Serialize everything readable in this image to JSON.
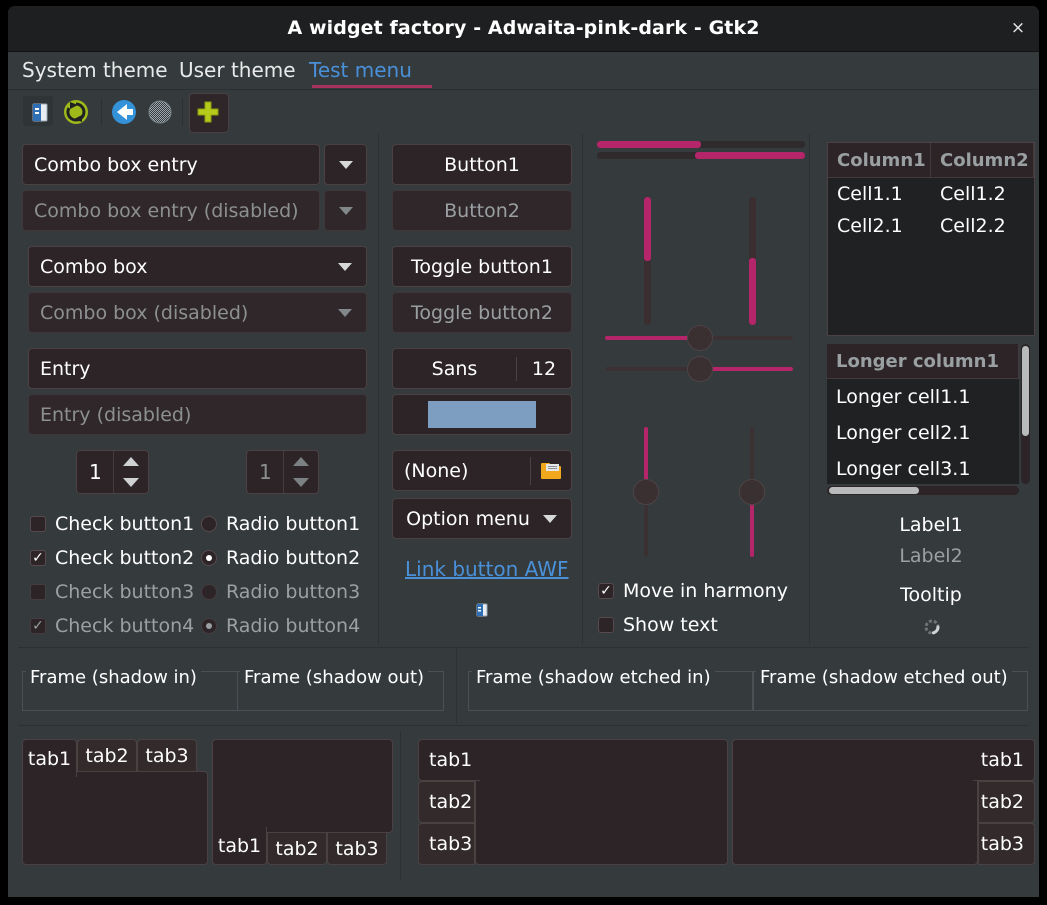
{
  "window": {
    "title": "A widget factory - Adwaita-pink-dark - Gtk2",
    "close_label": "×"
  },
  "colors": {
    "accent": "#b5256a",
    "link": "#4a90d9",
    "window_bg": "#353b3d",
    "titlebar_bg": "#1d1f20",
    "control_bg": "#2c2426",
    "control_border": "#4b4143",
    "color_swatch": "#7d9ec0",
    "folder_icon": "#f2a81d"
  },
  "menubar": {
    "items": [
      {
        "label": "System theme",
        "active": false
      },
      {
        "label": "User theme",
        "active": false
      },
      {
        "label": "Test menu",
        "active": true
      }
    ]
  },
  "toolbar": {
    "items": [
      {
        "name": "document-icon",
        "glyph": ""
      },
      {
        "name": "refresh-icon",
        "glyph": ""
      },
      {
        "name": "back-arrow-icon",
        "glyph": ""
      },
      {
        "name": "network-disabled-icon",
        "glyph": ""
      },
      {
        "name": "add-icon",
        "glyph": ""
      }
    ]
  },
  "left_column": {
    "combo_box_entry": {
      "value": "Combo box entry",
      "disabled": false
    },
    "combo_box_entry_disabled": {
      "value": "Combo box entry (disabled)",
      "disabled": true
    },
    "combo_box": {
      "value": "Combo box",
      "disabled": false
    },
    "combo_box_disabled": {
      "value": "Combo box (disabled)",
      "disabled": true
    },
    "entry": {
      "value": "Entry",
      "disabled": false
    },
    "entry_disabled": {
      "value": "Entry (disabled)",
      "disabled": true
    },
    "spin_button": {
      "value": "1",
      "disabled": false
    },
    "spin_button_disabled": {
      "value": "1",
      "disabled": true
    },
    "checks": [
      {
        "label": "Check button1",
        "checked": false,
        "disabled": false
      },
      {
        "label": "Check button2",
        "checked": true,
        "disabled": false
      },
      {
        "label": "Check button3",
        "checked": false,
        "disabled": true
      },
      {
        "label": "Check button4",
        "checked": true,
        "disabled": true
      }
    ],
    "radios": [
      {
        "label": "Radio button1",
        "checked": false,
        "disabled": false
      },
      {
        "label": "Radio button2",
        "checked": true,
        "disabled": false
      },
      {
        "label": "Radio button3",
        "checked": false,
        "disabled": true
      },
      {
        "label": "Radio button4",
        "checked": true,
        "disabled": true
      }
    ]
  },
  "middle_column": {
    "button1": {
      "label": "Button1",
      "disabled": false
    },
    "button2": {
      "label": "Button2",
      "disabled": true
    },
    "toggle1": {
      "label": "Toggle button1",
      "disabled": false
    },
    "toggle2": {
      "label": "Toggle button2",
      "disabled": true
    },
    "font_button": {
      "family": "Sans",
      "size": "12"
    },
    "color_button": {
      "swatch": "#7d9ec0"
    },
    "file_button": {
      "label": "(None)",
      "icon": "folder-icon"
    },
    "option_menu": {
      "label": "Option menu"
    },
    "link_button": {
      "label": "Link button AWF"
    },
    "small_icon": {
      "name": "document-icon"
    }
  },
  "scales_column": {
    "progress_h_top": {
      "value": 50,
      "inverted": false
    },
    "progress_h_bottom": {
      "value": 53,
      "inverted": true
    },
    "progress_v_left": {
      "value": 50,
      "inverted": false
    },
    "progress_v_right": {
      "value": 48,
      "inverted": true
    },
    "scale_h_top": {
      "value": 45
    },
    "scale_h_bottom": {
      "value": 45
    },
    "scale_v_left": {
      "value": 50
    },
    "scale_v_right": {
      "value": 50
    },
    "move_in_harmony": {
      "label": "Move in harmony",
      "checked": true
    },
    "show_text": {
      "label": "Show text",
      "checked": false
    }
  },
  "right_column": {
    "tree1": {
      "columns": [
        "Column1",
        "Column2"
      ],
      "rows": [
        [
          "Cell1.1",
          "Cell1.2"
        ],
        [
          "Cell2.1",
          "Cell2.2"
        ]
      ]
    },
    "tree2": {
      "columns": [
        "Longer column1"
      ],
      "rows": [
        [
          "Longer cell1.1"
        ],
        [
          "Longer cell2.1"
        ],
        [
          "Longer cell3.1"
        ]
      ]
    },
    "label1": "Label1",
    "label2": "Label2",
    "tooltip": "Tooltip",
    "spinner": "spinner-icon"
  },
  "frames": [
    {
      "label": "Frame (shadow in)"
    },
    {
      "label": "Frame (shadow out)"
    },
    {
      "label": "Frame (shadow etched in)"
    },
    {
      "label": "Frame (shadow etched out)"
    }
  ],
  "notebooks": [
    {
      "name": "notebook-tabs-top",
      "tabs": [
        "tab1",
        "tab2",
        "tab3"
      ],
      "selected": 0
    },
    {
      "name": "notebook-tabs-bottom",
      "tabs": [
        "tab1",
        "tab2",
        "tab3"
      ],
      "selected": 0
    },
    {
      "name": "notebook-tabs-left",
      "tabs": [
        "tab1",
        "tab2",
        "tab3"
      ],
      "selected": 0
    },
    {
      "name": "notebook-tabs-right",
      "tabs": [
        "tab1",
        "tab2",
        "tab3"
      ],
      "selected": 0
    }
  ]
}
